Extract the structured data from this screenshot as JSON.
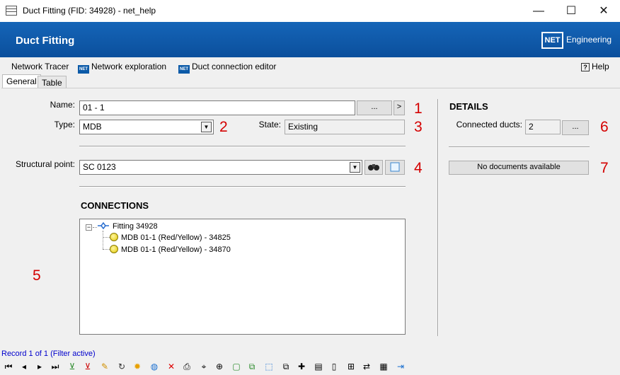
{
  "window": {
    "title": "Duct Fitting (FID: 34928) - net_help",
    "minimize": "—",
    "maximize": "☐",
    "close": "✕"
  },
  "banner": {
    "title": "Duct Fitting",
    "logo_text": "NET",
    "brand": "Engineering"
  },
  "menu": {
    "network_tracer": "Network Tracer",
    "network_exploration": "Network exploration",
    "duct_connection_editor": "Duct connection editor",
    "net_chip": "NET",
    "help": "Help"
  },
  "tabs": {
    "general": "General",
    "table": "Table"
  },
  "form": {
    "name_label": "Name:",
    "name_value": "01 - 1",
    "name_browse": "...",
    "name_next": ">",
    "type_label": "Type:",
    "type_value": "MDB",
    "state_label": "State:",
    "state_value": "Existing",
    "structural_label": "Structural point:",
    "structural_value": "SC 0123",
    "connections_title": "CONNECTIONS"
  },
  "details": {
    "title": "DETAILS",
    "connected_label": "Connected ducts:",
    "connected_value": "2",
    "connected_browse": "...",
    "no_documents": "No documents available"
  },
  "tree": {
    "root": "Fitting 34928",
    "children": [
      "MDB 01-1 (Red/Yellow) - 34825",
      "MDB 01-1 (Red/Yellow) - 34870"
    ]
  },
  "callouts": [
    "1",
    "2",
    "3",
    "4",
    "5",
    "6",
    "7"
  ],
  "record": {
    "text": "Record 1 of 1 (Filter active)"
  },
  "colors": {
    "banner": "#0b5aa8",
    "callout": "#d40000",
    "record_text": "#0000cc"
  },
  "toolbar_icons": [
    "first-record-icon",
    "previous-record-icon",
    "next-record-icon",
    "last-record-icon",
    "add-filter-icon",
    "remove-filter-icon",
    "edit-icon",
    "refresh-icon",
    "highlight-icon",
    "web-icon",
    "delete-icon",
    "print-icon",
    "select-icon",
    "zoom-icon",
    "layer-icon",
    "copy-layer-icon",
    "select-box-icon",
    "duplicate-icon",
    "new-icon",
    "report-icon",
    "document-icon",
    "attach-icon",
    "transfer-icon",
    "table-icon",
    "exit-icon"
  ]
}
